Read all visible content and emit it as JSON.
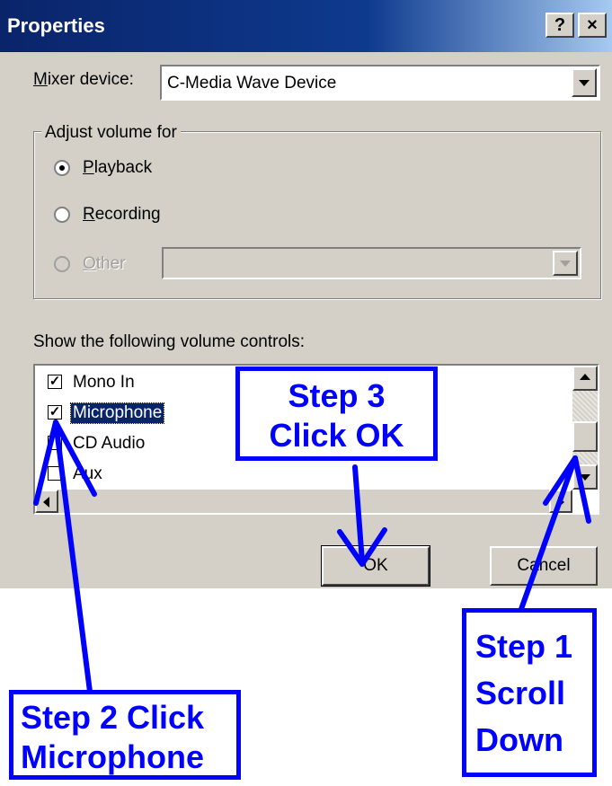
{
  "window": {
    "title": "Properties",
    "help_label": "?",
    "close_label": "×"
  },
  "mixer": {
    "label_prefix": "M",
    "label_rest": "ixer device:",
    "value": "C-Media Wave Device"
  },
  "adjust": {
    "group_title": "Adjust volume for",
    "playback_u": "P",
    "playback_rest": "layback",
    "recording_u": "R",
    "recording_rest": "ecording",
    "other_u": "O",
    "other_rest": "ther",
    "selected": "Playback"
  },
  "controls": {
    "heading": "Show the following volume controls:",
    "items": [
      {
        "label": "Mono In",
        "checked": true
      },
      {
        "label": "Microphone",
        "checked": true
      },
      {
        "label": "CD Audio",
        "checked": false
      },
      {
        "label": "Aux",
        "checked": false
      }
    ]
  },
  "buttons": {
    "ok": "OK",
    "cancel": "Cancel"
  },
  "annotations": {
    "step1_line1": "Step 1",
    "step1_line2": "Scroll",
    "step1_line3": "Down",
    "step2_line1": "Step 2 Click",
    "step2_line2": "Microphone",
    "step3_line1": "Step 3",
    "step3_line2": "Click OK",
    "color": "#0000ff"
  }
}
